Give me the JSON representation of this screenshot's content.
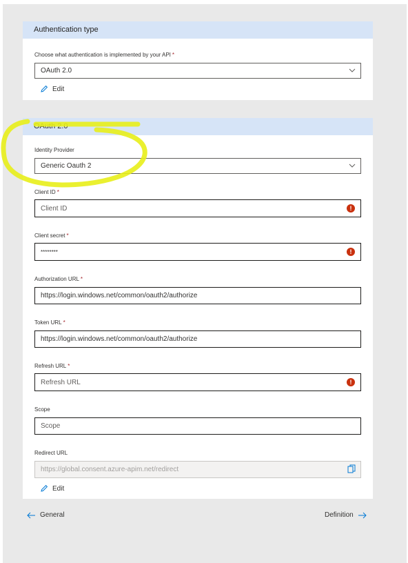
{
  "auth_type": {
    "header": "Authentication type",
    "question_label": "Choose what authentication is implemented by your API",
    "required_mark": "*",
    "selected": "OAuth 2.0",
    "edit_label": "Edit"
  },
  "oauth": {
    "header": "OAuth 2.0",
    "identity_provider": {
      "label": "Identity Provider",
      "selected": "Generic Oauth 2"
    },
    "client_id": {
      "label": "Client ID",
      "required_mark": "*",
      "placeholder": "Client ID",
      "value": ""
    },
    "client_secret": {
      "label": "Client secret",
      "required_mark": "*",
      "value": "********"
    },
    "authorization_url": {
      "label": "Authorization URL",
      "required_mark": "*",
      "value": "https://login.windows.net/common/oauth2/authorize"
    },
    "token_url": {
      "label": "Token URL",
      "required_mark": "*",
      "value": "https://login.windows.net/common/oauth2/authorize"
    },
    "refresh_url": {
      "label": "Refresh URL",
      "required_mark": "*",
      "placeholder": "Refresh URL",
      "value": ""
    },
    "scope": {
      "label": "Scope",
      "placeholder": "Scope",
      "value": ""
    },
    "redirect_url": {
      "label": "Redirect URL",
      "value": "https://global.consent.azure-apim.net/redirect"
    },
    "edit_label": "Edit"
  },
  "navigation": {
    "back_label": "General",
    "next_label": "Definition"
  },
  "colors": {
    "header_bg": "#d6e4f7",
    "error": "#c9310e",
    "accent": "#0078d4",
    "highlight": "#e8ee1a"
  },
  "icons": {
    "chevron": "chevron-down-icon",
    "error": "error-icon",
    "copy": "copy-icon",
    "edit": "pencil-icon",
    "back": "arrow-left-icon",
    "next": "arrow-right-icon"
  }
}
